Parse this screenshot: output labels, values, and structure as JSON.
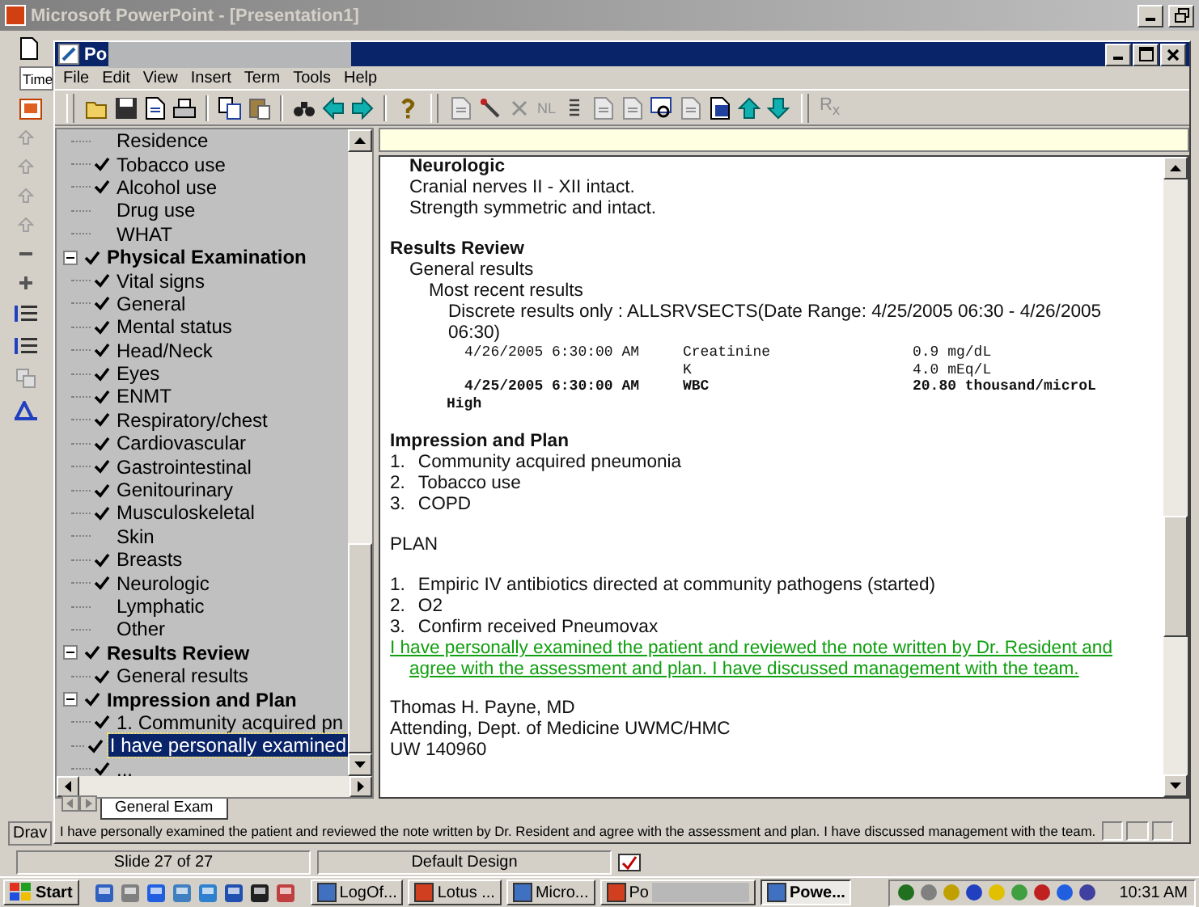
{
  "app_window": {
    "title": "Microsoft PowerPoint - [Presentation1]",
    "side_tab": "Time",
    "draw_toolbar_label": "Drav"
  },
  "note_window": {
    "title": "Po",
    "menu": [
      "File",
      "Edit",
      "View",
      "Insert",
      "Term",
      "Tools",
      "Help"
    ],
    "toolbar_labels": {
      "nl": "NL",
      "rx": "R$_{x}$"
    }
  },
  "tree": [
    {
      "children": [
        {
          "label": "Residence",
          "checked": false,
          "selected": false
        },
        {
          "label": "Tobacco use",
          "checked": true,
          "selected": false
        },
        {
          "label": "Alcohol use",
          "checked": true,
          "selected": false
        },
        {
          "label": "Drug use",
          "checked": false,
          "selected": false
        },
        {
          "label": "WHAT",
          "checked": false,
          "selected": false
        }
      ]
    },
    {
      "label": "Physical Examination",
      "checked": true,
      "expanded": true,
      "selected": false,
      "children": [
        {
          "label": "Vital signs",
          "checked": true,
          "selected": false
        },
        {
          "label": "General",
          "checked": true,
          "selected": false
        },
        {
          "label": "Mental status",
          "checked": true,
          "selected": false
        },
        {
          "label": "Head/Neck",
          "checked": true,
          "selected": false
        },
        {
          "label": "Eyes",
          "checked": true,
          "selected": false
        },
        {
          "label": "ENMT",
          "checked": true,
          "selected": false
        },
        {
          "label": "Respiratory/chest",
          "checked": true,
          "selected": false
        },
        {
          "label": "Cardiovascular",
          "checked": true,
          "selected": false
        },
        {
          "label": "Gastrointestinal",
          "checked": true,
          "selected": false
        },
        {
          "label": "Genitourinary",
          "checked": true,
          "selected": false
        },
        {
          "label": "Musculoskeletal",
          "checked": true,
          "selected": false
        },
        {
          "label": "Skin",
          "checked": false,
          "selected": false
        },
        {
          "label": "Breasts",
          "checked": true,
          "selected": false
        },
        {
          "label": "Neurologic",
          "checked": true,
          "selected": false
        },
        {
          "label": "Lymphatic",
          "checked": false,
          "selected": false
        },
        {
          "label": "Other",
          "checked": false,
          "selected": false
        }
      ]
    },
    {
      "label": "Results Review",
      "checked": true,
      "expanded": true,
      "selected": false,
      "children": [
        {
          "label": "General results",
          "checked": true,
          "selected": false
        }
      ]
    },
    {
      "label": "Impression and Plan",
      "checked": true,
      "expanded": true,
      "selected": false,
      "children": [
        {
          "label": "1.  Community acquired pn",
          "checked": true,
          "selected": false
        },
        {
          "label": "I have personally examined",
          "checked": true,
          "selected": true
        },
        {
          "label": "...",
          "checked": true,
          "selected": false
        }
      ]
    }
  ],
  "document": [
    {
      "kind": "subheading",
      "text": "Neurologic",
      "children": [
        {
          "kind": "text",
          "text": "Cranial nerves II - XII intact."
        },
        {
          "kind": "text",
          "text": "Strength symmetric and intact."
        }
      ]
    },
    {
      "kind": "heading",
      "text": "Results Review",
      "children": [
        {
          "kind": "text",
          "text": "General results",
          "children": [
            {
              "kind": "text",
              "text": "Most recent results",
              "children": [
                {
                  "kind": "text",
                  "text": "Discrete results only : ALLSRVSECTS(Date Range: 4/25/2005 06:30 - 4/26/2005 06:30)"
                },
                {
                  "kind": "results",
                  "rows": [
                    {
                      "date": "4/26/2005 6:30:00 AM",
                      "test": "Creatinine",
                      "value": "0.9 mg/dL",
                      "abnormal": false
                    },
                    {
                      "test": "K",
                      "value": "4.0 mEq/L",
                      "abnormal": false
                    },
                    {
                      "date": "4/25/2005 6:30:00 AM",
                      "test": "WBC",
                      "value": "20.80 thousand/microL",
                      "flag": "High",
                      "abnormal": true
                    }
                  ]
                }
              ]
            }
          ]
        }
      ]
    },
    {
      "kind": "heading",
      "text": "Impression and Plan"
    },
    {
      "kind": "list",
      "items": [
        {
          "num": "1.",
          "text": "Community acquired pneumonia"
        },
        {
          "num": "2.",
          "text": "Tobacco use"
        },
        {
          "num": "3.",
          "text": "COPD"
        }
      ]
    },
    {
      "kind": "plain",
      "text": "PLAN"
    },
    {
      "kind": "list",
      "items": [
        {
          "num": "1.",
          "text": "Empiric IV antibiotics directed at community pathogens (started)"
        },
        {
          "num": "2.",
          "text": "O2"
        },
        {
          "num": "3.",
          "text": "Confirm received Pneumovax"
        }
      ]
    },
    {
      "kind": "attestation",
      "text": "I have personally examined the patient and reviewed the note written by Dr. Resident and agree with the assessment and plan.  I have discussed management with the team."
    },
    {
      "kind": "signature",
      "lines": [
        "Thomas H. Payne, MD",
        "Attending, Dept. of Medicine UWMC/HMC",
        "UW 140960"
      ]
    }
  ],
  "sheet_tabs": [
    {
      "label": "General Exam",
      "selected": true
    }
  ],
  "note_status": "I have personally examined the patient and reviewed the note written by Dr. Resident and agree with the assessment and plan.  I have discussed management with the team.",
  "status_bar": {
    "slide": "Slide 27 of 27",
    "design": "Default Design"
  },
  "taskbar": {
    "start": "Start",
    "buttons": [
      {
        "label": "LogOf...",
        "selected": false
      },
      {
        "label": "Lotus ...",
        "selected": false
      },
      {
        "label": "Micro...",
        "selected": false
      },
      {
        "label": "Po",
        "redacted": true,
        "selected": false
      },
      {
        "label": "Powe...",
        "selected": true
      }
    ],
    "clock": "10:31 AM"
  }
}
